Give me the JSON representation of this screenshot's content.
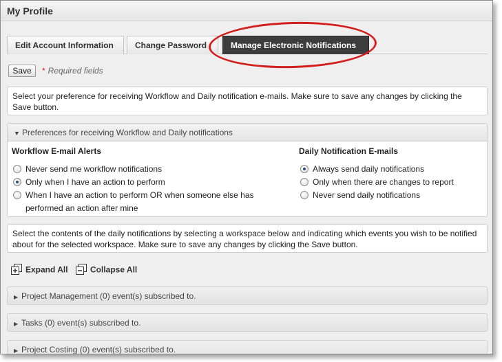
{
  "window": {
    "title": "My Profile"
  },
  "tabs": [
    {
      "label": "Edit Account Information"
    },
    {
      "label": "Change Password"
    },
    {
      "label": "Manage Electronic Notifications"
    }
  ],
  "toolbar": {
    "save_label": "Save",
    "required_star": "*",
    "required_text": "Required fields"
  },
  "intro_text": "Select your preference for receiving Workflow and Daily notification e-mails. Make sure to save any changes by clicking the Save button.",
  "preferences": {
    "header": "Preferences for receiving Workflow and Daily notifications",
    "workflow": {
      "title": "Workflow E-mail Alerts",
      "options": [
        {
          "label": "Never send me workflow notifications",
          "selected": false
        },
        {
          "label": "Only when I have an action to perform",
          "selected": true
        },
        {
          "label": "When I have an action to perform OR when someone else has performed an action after mine",
          "selected": false
        }
      ]
    },
    "daily": {
      "title": "Daily Notification E-mails",
      "options": [
        {
          "label": "Always send daily notifications",
          "selected": true
        },
        {
          "label": "Only when there are changes to report",
          "selected": false
        },
        {
          "label": "Never send daily notifications",
          "selected": false
        }
      ]
    }
  },
  "contents_text": "Select the contents of the daily notifications by selecting a workspace below and indicating which events you wish to be notified about for the selected workspace. Make sure to save any changes by clicking the Save button.",
  "actions": {
    "expand_all": "Expand All",
    "collapse_all": "Collapse All"
  },
  "workspaces": [
    {
      "label": "Project Management (0) event(s) subscribed to."
    },
    {
      "label": "Tasks (0) event(s) subscribed to."
    },
    {
      "label": "Project Costing (0) event(s) subscribed to."
    }
  ],
  "colors": {
    "highlight_oval": "#d41f1f",
    "active_tab": "#3d3d3d",
    "required_star": "#d22222"
  }
}
